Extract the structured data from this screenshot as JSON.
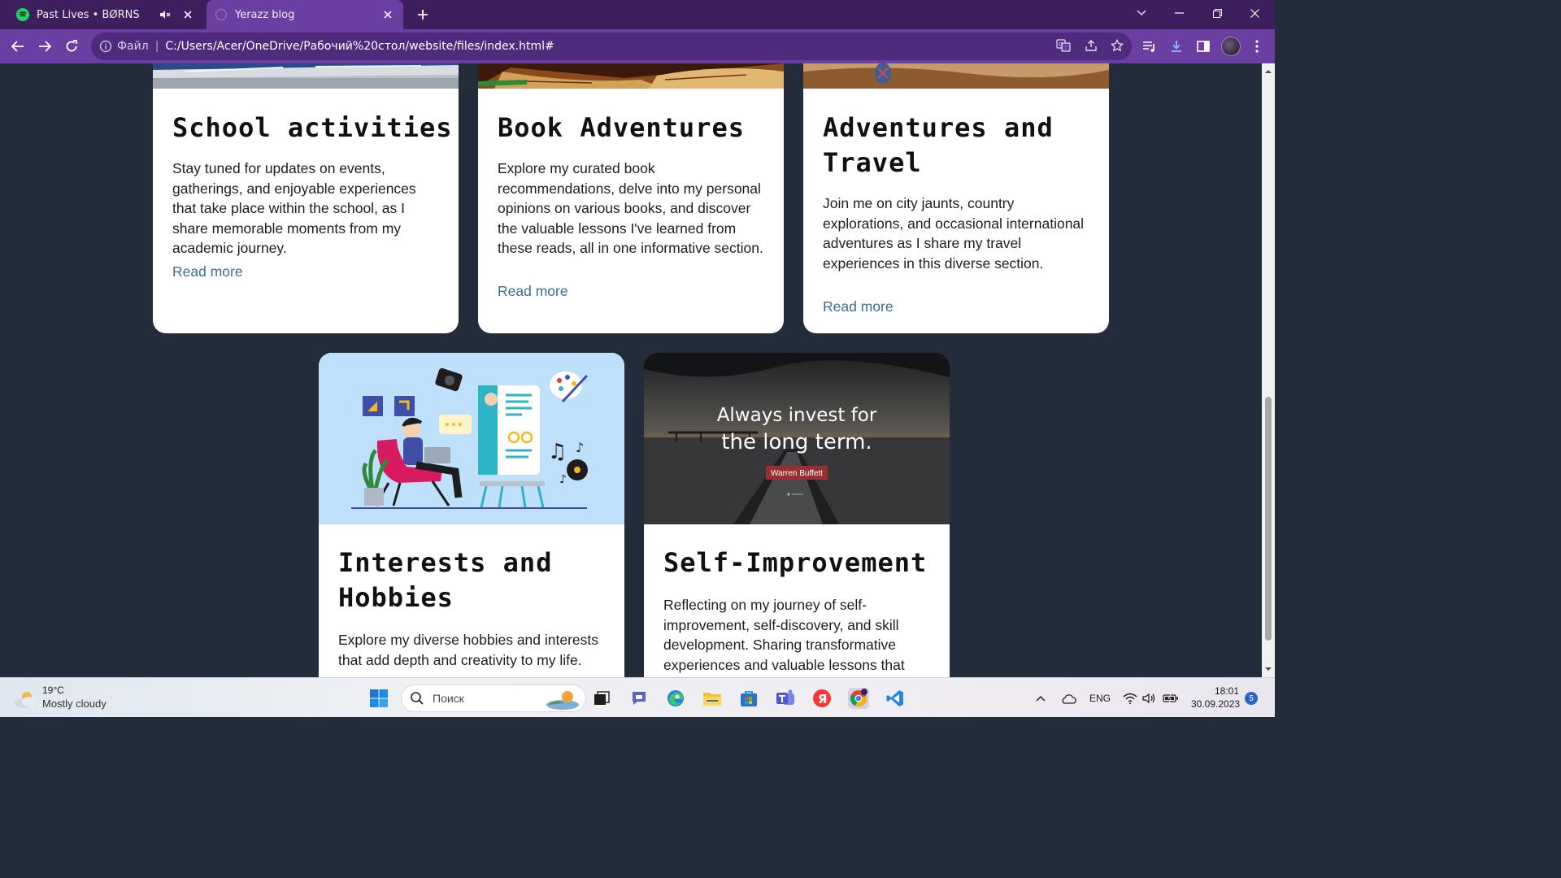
{
  "tabs": [
    {
      "title": "Past Lives • BØRNS",
      "active": false
    },
    {
      "title": "Yerazz blog",
      "active": true
    }
  ],
  "address_bar": {
    "scheme_label": "Файл",
    "url": "C:/Users/Acer/OneDrive/Рабочий%20стол/website/files/index.html#"
  },
  "cards": [
    {
      "title": "School activities",
      "text": "Stay tuned for updates on events, gatherings, and enjoyable experiences that take place within the school, as I share memorable moments from my academic journey.",
      "link": "Read more"
    },
    {
      "title": "Book Adventures",
      "text": "Explore my curated book recommendations, delve into my personal opinions on various books, and discover the valuable lessons I've learned from these reads, all in one informative section.",
      "link": "Read more"
    },
    {
      "title": "Adventures and Travel",
      "text": "Join me on city jaunts, country explorations, and occasional international adventures as I share my travel experiences in this diverse section.",
      "link": "Read more"
    },
    {
      "title": "Interests and Hobbies",
      "text": "Explore my diverse hobbies and interests that add depth and creativity to my life.",
      "image_caption": ""
    },
    {
      "title": "Self-Improvement",
      "text": "Reflecting on my journey of self-improvement, self-discovery, and skill development. Sharing transformative experiences and valuable lessons that",
      "quote_line1": "Always invest for",
      "quote_line2": "the long term.",
      "quote_author": "Warren Buffett"
    }
  ],
  "taskbar": {
    "weather_temp": "19°C",
    "weather_desc": "Mostly cloudy",
    "search_placeholder": "Поиск",
    "language": "ENG",
    "time": "18:01",
    "date": "30.09.2023",
    "notification_count": "5"
  },
  "colors": {
    "tabbar": "#3d1f5e",
    "toolbar": "#6a3fa1",
    "page_bg": "#232c3b",
    "card_bg": "#ffffff",
    "link": "#3b6e8c"
  }
}
